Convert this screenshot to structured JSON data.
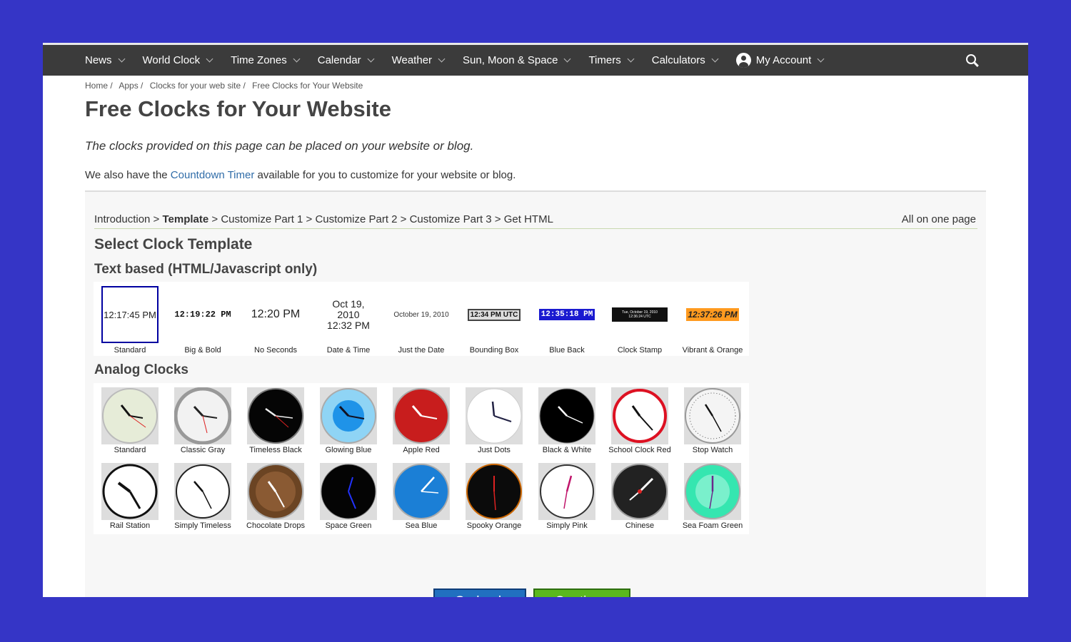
{
  "nav": {
    "items": [
      {
        "label": "News"
      },
      {
        "label": "World Clock"
      },
      {
        "label": "Time Zones"
      },
      {
        "label": "Calendar"
      },
      {
        "label": "Weather"
      },
      {
        "label": "Sun, Moon & Space"
      },
      {
        "label": "Timers"
      },
      {
        "label": "Calculators"
      }
    ],
    "account": "My Account"
  },
  "breadcrumb": [
    "Home /",
    "Apps /",
    "Clocks for your web site /",
    "Free Clocks for Your Website"
  ],
  "title": "Free Clocks for Your Website",
  "intro": "The clocks provided on this page can be placed on your website or blog.",
  "also": {
    "before": "We also have the ",
    "link": "Countdown Timer",
    "after": " available for you to customize for your website or blog."
  },
  "steps": {
    "intro": "Introduction > ",
    "current": "Template",
    "rest": " > Customize Part 1 > Customize Part 2 > Customize Part 3 > Get HTML"
  },
  "all_on_one_page": "All on one page",
  "select_heading": "Select Clock Template",
  "text_heading": "Text based (HTML/Javascript only)",
  "analog_heading": "Analog Clocks",
  "text_templates": [
    {
      "sample": "12:17:45 PM",
      "caption": "Standard"
    },
    {
      "sample": "12:19:22 PM",
      "caption": "Big & Bold"
    },
    {
      "sample": "12:20 PM",
      "caption": "No Seconds"
    },
    {
      "sample": "Oct 19, 2010",
      "sample2": "12:32 PM",
      "caption": "Date & Time"
    },
    {
      "sample": "October 19, 2010",
      "caption": "Just the Date"
    },
    {
      "sample": "12:34 PM UTC",
      "caption": "Bounding Box"
    },
    {
      "sample": "12:35:18 PM",
      "caption": "Blue Back"
    },
    {
      "sample": "Tue, October 19, 2010",
      "sample2": "12:36:24 UTC",
      "caption": "Clock Stamp"
    },
    {
      "sample": "12:37:26 PM",
      "caption": "Vibrant & Orange"
    }
  ],
  "analog_row1": [
    "Standard",
    "Classic Gray",
    "Timeless Black",
    "Glowing Blue",
    "Apple Red",
    "Just Dots",
    "Black & White",
    "School Clock Red",
    "Stop Watch"
  ],
  "analog_row2": [
    "Rail Station",
    "Simply Timeless",
    "Chocolate Drops",
    "Space Green",
    "Sea Blue",
    "Spooky Orange",
    "Simply Pink",
    "Chinese",
    "Sea Foam Green"
  ],
  "buttons": {
    "back": "Go back",
    "continue": "Continue"
  },
  "colors": {
    "page_bg": "#3535c6",
    "nav_bg": "#3b3b3b",
    "link": "#2f6ca8",
    "back_btn": "#2170c0",
    "continue_btn": "#5ab81e",
    "selected_border": "#0000a0"
  }
}
